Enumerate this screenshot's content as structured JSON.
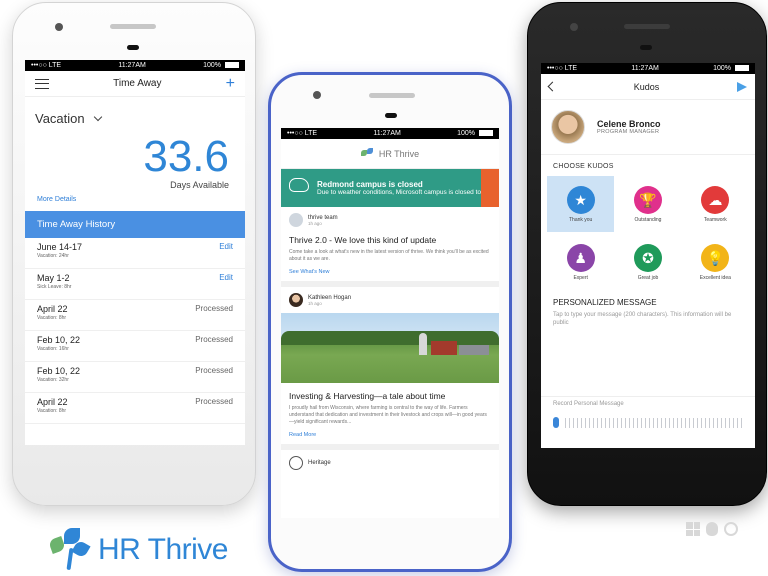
{
  "status": {
    "carrier": "•••○○ LTE",
    "time": "11:27AM",
    "battery": "100%"
  },
  "left": {
    "title": "Time Away",
    "add": "+",
    "dropdown": "Vacation",
    "days_value": "33.6",
    "days_label": "Days Available",
    "more_details": "More Details",
    "history_header": "Time Away History",
    "rows": [
      {
        "date": "June 14-17",
        "sub": "Vacation: 24hr",
        "status": "Edit"
      },
      {
        "date": "May 1-2",
        "sub": "Sick Leave: 8hr",
        "status": "Edit"
      },
      {
        "date": "April 22",
        "sub": "Vacation: 8hr",
        "status": "Processed"
      },
      {
        "date": "Feb 10, 22",
        "sub": "Vacation: 16hr",
        "status": "Processed"
      },
      {
        "date": "Feb 10, 22",
        "sub": "Vacation: 32hr",
        "status": "Processed"
      },
      {
        "date": "April 22",
        "sub": "Vacation: 8hr",
        "status": "Processed"
      }
    ]
  },
  "center": {
    "app_name": "HR Thrive",
    "banner": {
      "title": "Redmond campus is closed",
      "text": "Due to weather conditions, Microsoft campus is closed today"
    },
    "post1": {
      "author": "thrive team",
      "timestamp": "1h ago",
      "title": "Thrive 2.0 - We love this kind of update",
      "body": "Come take a look at what's new in the latest version of thrive. We think you'll be as excited about it as we are.",
      "link": "See What's New"
    },
    "post2": {
      "author": "Kathleen Hogan",
      "timestamp": "1h ago",
      "title": "Investing & Harvesting—a tale about time",
      "body": "I proudly hail from Wisconsin, where farming is central to the way of life. Farmers understand that dedication and investment in their livestock and crops will—in good years—yield significant rewards...",
      "link": "Read More"
    },
    "post3": {
      "author": "Heritage"
    }
  },
  "right": {
    "title": "Kudos",
    "profile": {
      "name": "Celene Bronco",
      "role": "PROGRAM MANAGER"
    },
    "choose_label": "CHOOSE KUDOS",
    "kudos": [
      {
        "label": "Thank you",
        "color": "#2f86d6",
        "glyph": "★",
        "selected": true
      },
      {
        "label": "Outstanding",
        "color": "#e0308c",
        "glyph": "🏆"
      },
      {
        "label": "Teamwork",
        "color": "#e23a3a",
        "glyph": "☁"
      },
      {
        "label": "Expert",
        "color": "#8a45a8",
        "glyph": "♟"
      },
      {
        "label": "Great job",
        "color": "#1f9a5a",
        "glyph": "✪"
      },
      {
        "label": "Excellent idea",
        "color": "#f2b418",
        "glyph": "💡"
      }
    ],
    "message_title": "PERSONALIZED MESSAGE",
    "message_placeholder": "Tap to type your message (200 characters). This information will be public",
    "record_placeholder": "Record Personal Message"
  },
  "brand": {
    "name": "HR Thrive",
    "accent": "#2f86d6",
    "green": "#6cb36e"
  }
}
